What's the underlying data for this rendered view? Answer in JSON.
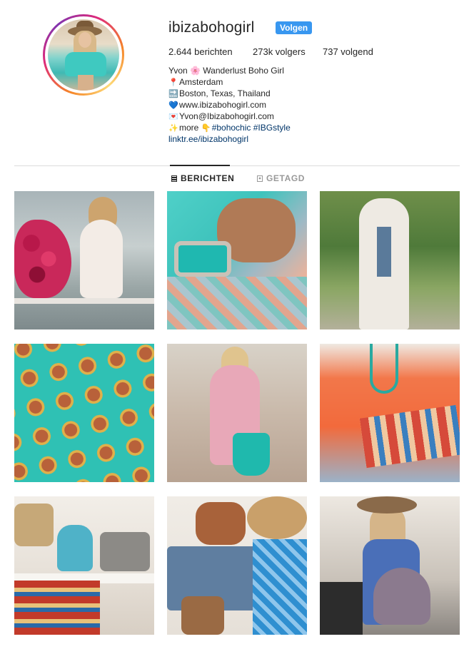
{
  "profile": {
    "username": "ibizabohogirl",
    "follow_label": "Volgen",
    "stats": {
      "posts": "2.644 berichten",
      "followers": "273k volgers",
      "following": "737 volgend"
    },
    "bio": {
      "name": "Yvon 🌸 Wanderlust Boho Girl",
      "location": "Amsterdam",
      "places": "Boston, Texas, Thailand",
      "website": "www.ibizabohogirl.com",
      "email": "Yvon@Ibizabohogirl.com",
      "more": "more",
      "hashtags": "#bohochic #IBGstyle",
      "link": "linktr.ee/ibizabohogirl"
    }
  },
  "tabs": {
    "posts_label": "BERICHTEN",
    "tagged_label": "GETAGD"
  },
  "grid": {
    "posts": [
      {
        "subject": "woman in white dress with flowers by canal"
      },
      {
        "subject": "hand with turquoise rings and bracelets"
      },
      {
        "subject": "woman in white embroidered kimono"
      },
      {
        "subject": "turquoise ring collection"
      },
      {
        "subject": "woman in pink dress with turquoise bag"
      },
      {
        "subject": "orange top with embroidered clutch"
      },
      {
        "subject": "boho bags and rug display"
      },
      {
        "subject": "flatlay denim shorts, boots, hat"
      },
      {
        "subject": "woman with hat and boho bag"
      }
    ]
  },
  "colors": {
    "follow_button": "#3897f0",
    "link": "#003569",
    "text": "#262626",
    "muted": "#999999",
    "divider": "#dbdbdb"
  }
}
